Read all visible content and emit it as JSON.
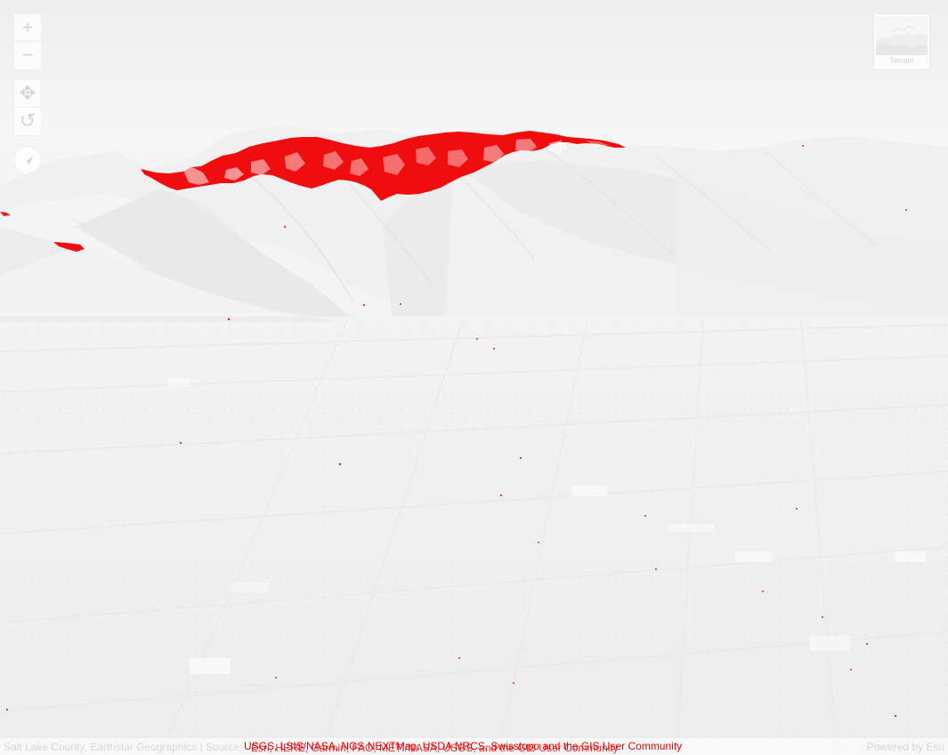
{
  "controls": {
    "zoom_in": "+",
    "zoom_out": "−",
    "pan": "✥",
    "rotate": "↺",
    "compass": "➤"
  },
  "basemap": {
    "label": "Terrain"
  },
  "attribution": {
    "base": "Salt Lake County, Earthstar Geographics | Source:",
    "overlay_primary": "USGS, LSIS/NASA, NGS NEXTMap, USDA NRCS, Swisstopo and the GIS User Community",
    "overlay_secondary": "Esri, HERE, Garmin, FAO, METI/NASA, USGS, and the GIS User Community",
    "powered_by": "Powered by Esri"
  },
  "colors": {
    "background": "#f2f2f2",
    "highlight": "#e30000",
    "ui_icon": "#d6d6d6"
  },
  "icons": {
    "zoom_in": "plus-icon",
    "zoom_out": "minus-icon",
    "pan": "pan-icon",
    "rotate": "rotate-icon",
    "compass": "compass-icon",
    "basemap": "terrain-thumbnail-icon"
  }
}
